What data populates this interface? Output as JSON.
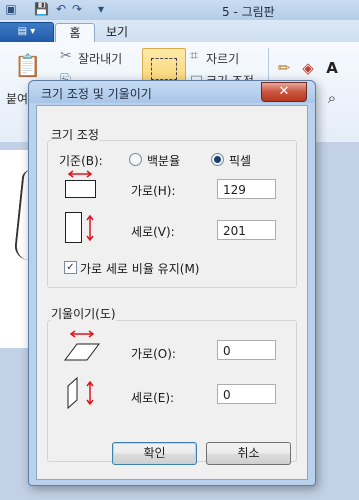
{
  "app": {
    "window_title": "5 - 그림판",
    "tabs": [
      "홈",
      "보기"
    ],
    "ribbon": {
      "paste_label": "붙여",
      "cut_label": "잘라내기",
      "crop_label": "자르기",
      "resize_label": "크기 조정"
    }
  },
  "dialog": {
    "title": "크기 조정 및 기울이기",
    "close_symbol": "✕",
    "resize": {
      "section_title": "크기 조정",
      "basis_label": "기준(B):",
      "option_percent": "백분율",
      "option_pixels": "픽셀",
      "selected_option": "픽셀",
      "horizontal_label": "가로(H):",
      "horizontal_value": "129",
      "vertical_label": "세로(V):",
      "vertical_value": "201",
      "keep_ratio_label": "가로 세로 비율 유지(M)",
      "keep_ratio_checked": true
    },
    "skew": {
      "section_title": "기울이기(도)",
      "horizontal_label": "가로(O):",
      "horizontal_value": "0",
      "vertical_label": "세로(E):",
      "vertical_value": "0"
    },
    "buttons": {
      "ok": "확인",
      "cancel": "취소"
    }
  },
  "colors": {
    "arrow_red": "#e0141e",
    "dialog_frame": "#b9d1ec",
    "close_button": "#c9543f"
  }
}
